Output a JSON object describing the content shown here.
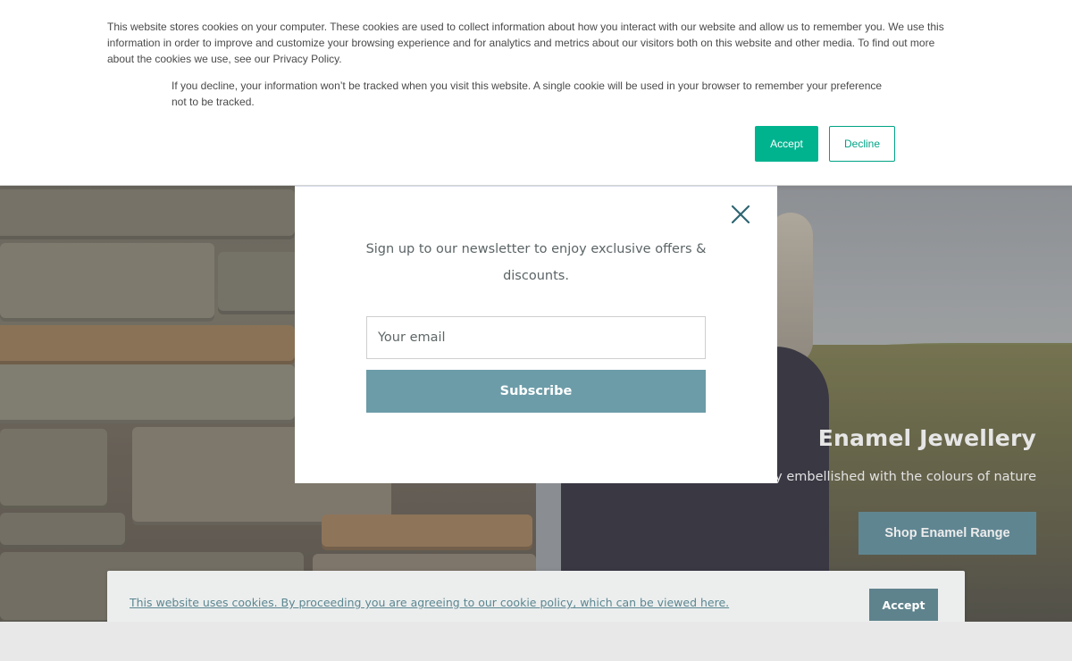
{
  "cookie_banner": {
    "paragraph1": "This website stores cookies on your computer. These cookies are used to collect information about how you interact with our website and allow us to remember you. We use this information in order to improve and customize your browsing experience and for analytics and metrics about our visitors both on this website and other media. To find out more about the cookies we use, see our Privacy Policy.",
    "paragraph2": "If you decline, your information won’t be tracked when you visit this website. A single cookie will be used in your browser to remember your preference not to be tracked.",
    "accept_label": "Accept",
    "decline_label": "Decline"
  },
  "newsletter_modal": {
    "text": "Sign up to our newsletter to enjoy exclusive offers & discounts.",
    "email_placeholder": "Your email",
    "subscribe_label": "Subscribe",
    "close_icon": "close-icon"
  },
  "hero": {
    "title": "Enamel Jewellery",
    "subtitle": "ery embellished with the colours of nature",
    "cta_label": "Shop Enamel Range"
  },
  "cookie_bar": {
    "message": "This website uses cookies. By proceeding you are agreeing to our cookie policy, which can be viewed here.",
    "accept_label": "Accept"
  },
  "colors": {
    "accept_green": "#00b38f",
    "subscribe_teal": "#6c9ca8",
    "bar_button": "#5e838d",
    "link_teal": "#5b8690"
  }
}
